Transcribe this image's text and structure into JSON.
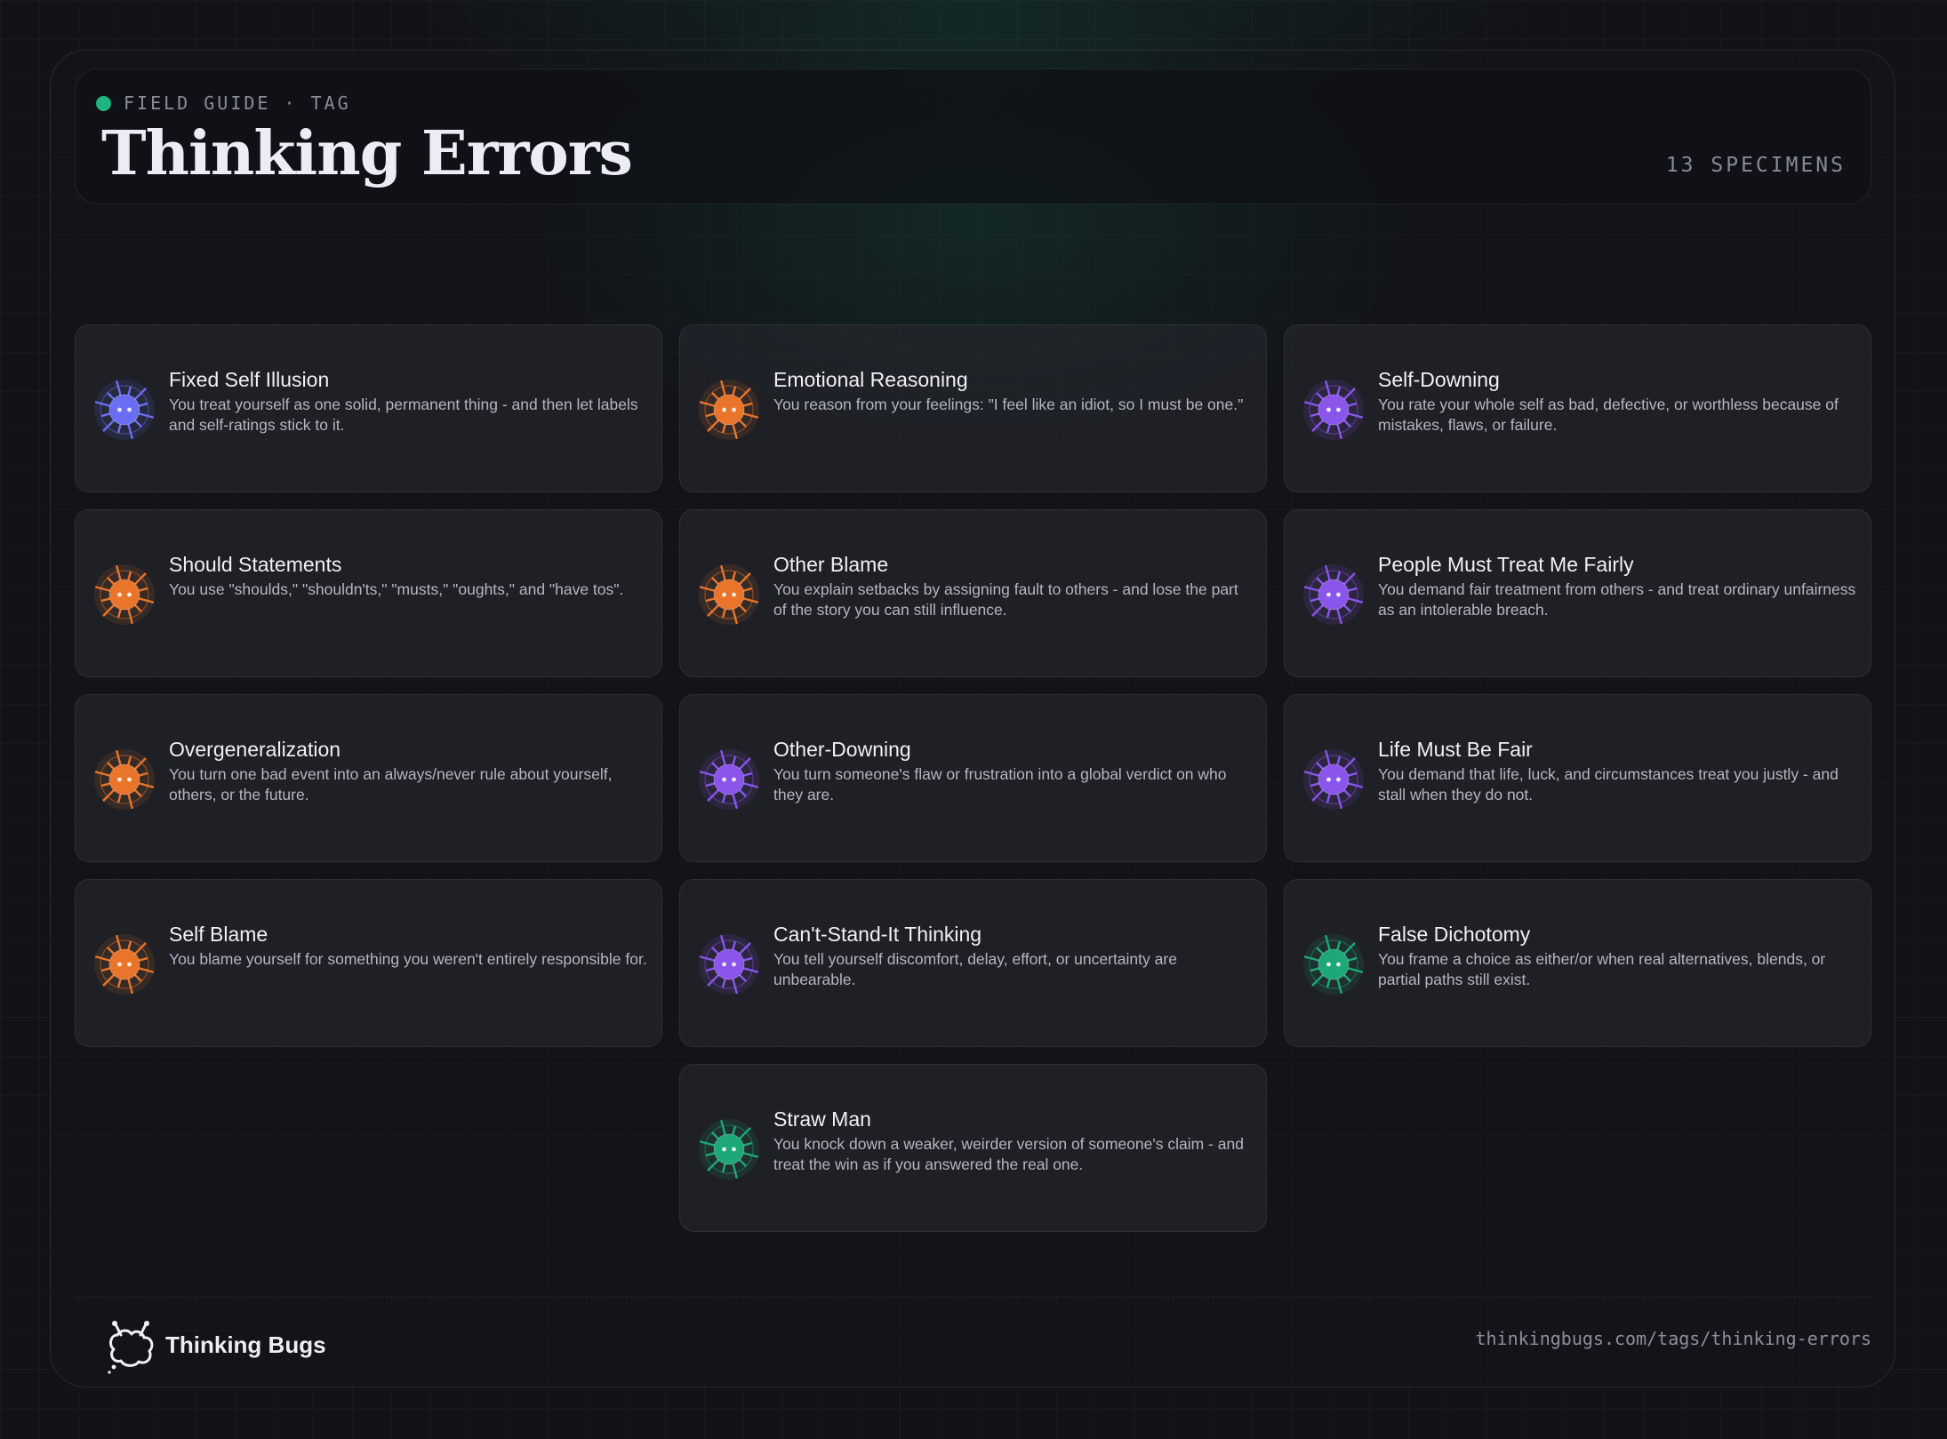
{
  "header": {
    "kicker": "FIELD GUIDE · TAG",
    "title": "Thinking Errors",
    "count": "13 SPECIMENS"
  },
  "colors": {
    "accent": "#1db582",
    "blue": "#6b6ef2",
    "orange": "#e8752a",
    "purple": "#8a55ea",
    "green": "#1ea877"
  },
  "cards": [
    {
      "name": "Fixed Self Illusion",
      "desc": "You treat yourself as one solid, permanent thing - and then let labels and self-ratings stick to it.",
      "icon": "bug-icon-blue"
    },
    {
      "name": "Emotional Reasoning",
      "desc": "You reason from your feelings: \"I feel like an idiot, so I must be one.\"",
      "icon": "bug-icon-orange"
    },
    {
      "name": "Self-Downing",
      "desc": "You rate your whole self as bad, defective, or worthless because of mistakes, flaws, or failure.",
      "icon": "bug-icon-purple"
    },
    {
      "name": "Should Statements",
      "desc": "You use \"shoulds,\" \"shouldn'ts,\" \"musts,\" \"oughts,\" and \"have tos\".",
      "icon": "bug-icon-orange"
    },
    {
      "name": "Other Blame",
      "desc": "You explain setbacks by assigning fault to others - and lose the part of the story you can still influence.",
      "icon": "bug-icon-orange"
    },
    {
      "name": "People Must Treat Me Fairly",
      "desc": "You demand fair treatment from others - and treat ordinary unfairness as an intolerable breach.",
      "icon": "bug-icon-purple"
    },
    {
      "name": "Overgeneralization",
      "desc": "You turn one bad event into an always/never rule about yourself, others, or the future.",
      "icon": "bug-icon-orange"
    },
    {
      "name": "Other-Downing",
      "desc": "You turn someone's flaw or frustration into a global verdict on who they are.",
      "icon": "bug-icon-purple"
    },
    {
      "name": "Life Must Be Fair",
      "desc": "You demand that life, luck, and circumstances treat you justly - and stall when they do not.",
      "icon": "bug-icon-purple"
    },
    {
      "name": "Self Blame",
      "desc": "You blame yourself for something you weren't entirely responsible for.",
      "icon": "bug-icon-orange"
    },
    {
      "name": "Can't-Stand-It Thinking",
      "desc": "You tell yourself discomfort, delay, effort, or uncertainty are unbearable.",
      "icon": "bug-icon-purple"
    },
    {
      "name": "False Dichotomy",
      "desc": "You frame a choice as either/or when real alternatives, blends, or partial paths still exist.",
      "icon": "bug-icon-green"
    },
    {
      "name": "Straw Man",
      "desc": "You knock down a weaker, weirder version of someone's claim - and treat the win as if you answered the real one.",
      "icon": "bug-icon-green"
    }
  ],
  "footer": {
    "brand": "Thinking Bugs",
    "url": "thinkingbugs.com/tags/thinking-errors"
  }
}
